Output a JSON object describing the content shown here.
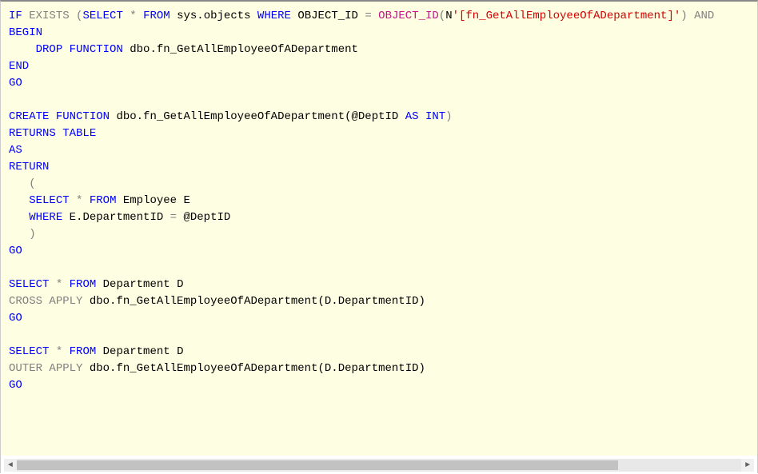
{
  "code": {
    "line1": {
      "if": "IF",
      "exists": "EXISTS",
      "p1": " (",
      "select": "SELECT",
      "star": " * ",
      "from": "FROM",
      "obj": " sys.objects ",
      "where": "WHERE",
      "objid": " OBJECT_ID ",
      "eq": "=",
      "fn": " OBJECT_ID",
      "p2": "(",
      "n": "N",
      "str": "'[fn_GetAllEmployeeOfADepartment]'",
      "p3": ") ",
      "and": "AND"
    },
    "line2": "BEGIN",
    "line3": {
      "indent": "    ",
      "drop": "DROP",
      "sp": " ",
      "function": "FUNCTION",
      "name": " dbo.fn_GetAllEmployeeOfADepartment"
    },
    "line4": "END",
    "line5": "GO",
    "line7": {
      "create": "CREATE",
      "sp": " ",
      "function": "FUNCTION",
      "name": " dbo.fn_GetAllEmployeeOfADepartment(@DeptID ",
      "as": "AS",
      "sp2": " ",
      "int": "INT",
      "p": ")"
    },
    "line8": {
      "returns": "RETURNS",
      "sp": " ",
      "table": "TABLE"
    },
    "line9": "AS",
    "line10": "RETURN",
    "line11": "   (",
    "line12": {
      "indent": "   ",
      "select": "SELECT",
      "star": " * ",
      "from": "FROM",
      "rest": " Employee E"
    },
    "line13": {
      "indent": "   ",
      "where": "WHERE",
      "rest": " E.DepartmentID ",
      "eq": "=",
      "rest2": " @DeptID"
    },
    "line14": "   )",
    "line15": "GO",
    "line17": {
      "select": "SELECT",
      "star": " * ",
      "from": "FROM",
      "rest": " Department D"
    },
    "line18": {
      "cross": "CROSS",
      "sp": " ",
      "apply": "APPLY",
      "rest": " dbo.fn_GetAllEmployeeOfADepartment(D.DepartmentID)"
    },
    "line19": "GO",
    "line21": {
      "select": "SELECT",
      "star": " * ",
      "from": "FROM",
      "rest": " Department D"
    },
    "line22": {
      "outer": "OUTER",
      "sp": " ",
      "apply": "APPLY",
      "rest": " dbo.fn_GetAllEmployeeOfADepartment(D.DepartmentID)"
    },
    "line23": "GO"
  },
  "scroll": {
    "left": "◄",
    "right": "►"
  }
}
